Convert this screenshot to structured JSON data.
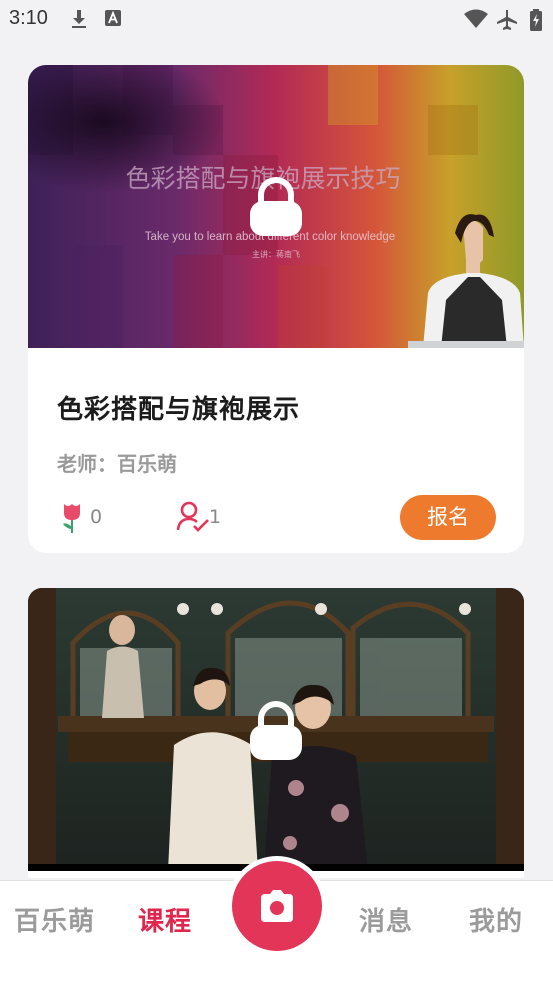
{
  "status_bar": {
    "time": "3:10",
    "icons": [
      "download-icon",
      "keyboard-a-icon",
      "wifi-icon",
      "airplane-icon",
      "battery-icon"
    ]
  },
  "courses": [
    {
      "thumbnail": {
        "title": "色彩搭配与旗袍展示技巧",
        "subtitle": "Take you to learn about different color knowledge",
        "presenter": "主讲：蒋南飞"
      },
      "title": "色彩搭配与旗袍展示",
      "teacher": "老师：百乐萌",
      "likes": "0",
      "enrolled": "1",
      "signup_label": "报名",
      "locked": true
    },
    {
      "thumbnail": {},
      "locked": true
    }
  ],
  "bottom_nav": {
    "items": [
      {
        "label": "百乐萌",
        "active": false
      },
      {
        "label": "课程",
        "active": true
      },
      {
        "label": "消息",
        "active": false
      },
      {
        "label": "我的",
        "active": false
      }
    ],
    "camera_icon": "camera-icon"
  },
  "colors": {
    "accent": "#e1264d",
    "signup": "#ee7a2d",
    "camera": "#e33557"
  }
}
